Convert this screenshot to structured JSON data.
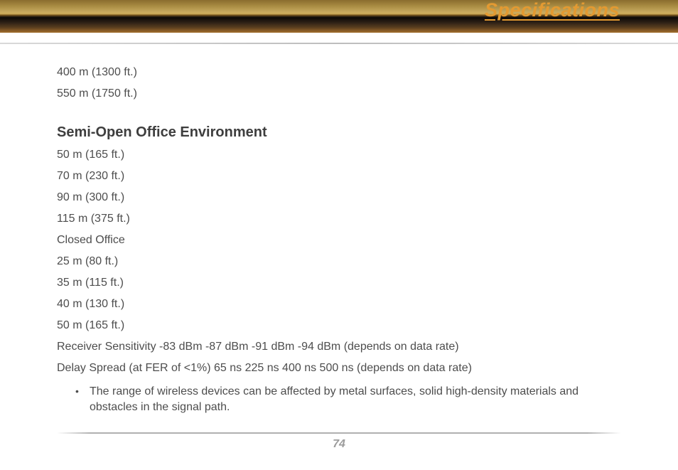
{
  "header": {
    "title": "Specifications"
  },
  "content": {
    "topValues": [
      "400 m (1300 ft.)",
      "550 m (1750 ft.)"
    ],
    "subhead": "Semi-Open Office Environment",
    "lines": [
      "50 m (165 ft.)",
      "70 m (230 ft.)",
      "90 m (300 ft.)",
      "115 m (375 ft.)",
      "Closed Office",
      "25 m (80 ft.)",
      "35 m (115 ft.)",
      "40 m (130 ft.)",
      "50 m (165 ft.)",
      "Receiver Sensitivity -83 dBm -87 dBm -91 dBm -94 dBm (depends on data rate)",
      "Delay Spread (at FER of <1%) 65 ns 225 ns 400 ns 500 ns (depends on data rate)"
    ],
    "bullet": "The range of wireless devices can be affected by metal surfaces, solid high-density materials and obstacles in the signal path."
  },
  "footer": {
    "pageNumber": "74"
  }
}
